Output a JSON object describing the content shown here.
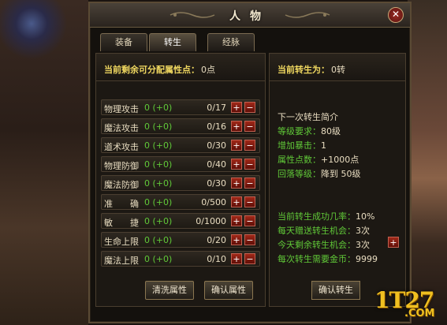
{
  "window": {
    "title": "人物",
    "close_label": "✕"
  },
  "tabs": [
    {
      "label": "装备",
      "active": false
    },
    {
      "label": "转生",
      "active": true
    },
    {
      "label": "经脉",
      "active": false
    }
  ],
  "left_panel": {
    "header_label": "当前剩余可分配属性点：",
    "header_value": "0点",
    "attributes": [
      {
        "name": "物理攻击",
        "value": "0 (+0)",
        "limit": "0/17"
      },
      {
        "name": "魔法攻击",
        "value": "0 (+0)",
        "limit": "0/16"
      },
      {
        "name": "道术攻击",
        "value": "0 (+0)",
        "limit": "0/30"
      },
      {
        "name": "物理防御",
        "value": "0 (+0)",
        "limit": "0/40"
      },
      {
        "name": "魔法防御",
        "value": "0 (+0)",
        "limit": "0/30"
      },
      {
        "name": "准　　确",
        "value": "0 (+0)",
        "limit": "0/500"
      },
      {
        "name": "敏　　捷",
        "value": "0 (+0)",
        "limit": "0/1000"
      },
      {
        "name": "生命上限",
        "value": "0 (+0)",
        "limit": "0/20"
      },
      {
        "name": "魔法上限",
        "value": "0 (+0)",
        "limit": "0/10"
      }
    ],
    "plus_label": "+",
    "minus_label": "−",
    "reset_button": "清洗属性",
    "confirm_button": "确认属性"
  },
  "right_panel": {
    "current_label": "当前转生为：",
    "current_value": "0转",
    "next_title": "下一次转生简介",
    "next_info": [
      {
        "key": "等级要求：",
        "value": "80级"
      },
      {
        "key": "增加暴击：",
        "value": "1"
      },
      {
        "key": "属性点数：",
        "value": "+1000点"
      },
      {
        "key": "回落等级：",
        "value": "降到 50级"
      }
    ],
    "stats": [
      {
        "key": "当前转生成功几率：",
        "value": "10%"
      },
      {
        "key": "每天赠送转生机会：",
        "value": "3次"
      },
      {
        "key": "今天剩余转生机会：",
        "value": "3次"
      },
      {
        "key": "每次转生需要金币：",
        "value": "9999"
      }
    ],
    "add_chance_label": "+",
    "confirm_rebirth_button": "确认转生"
  },
  "watermark": {
    "text": "1T27",
    "suffix": ".COM"
  }
}
